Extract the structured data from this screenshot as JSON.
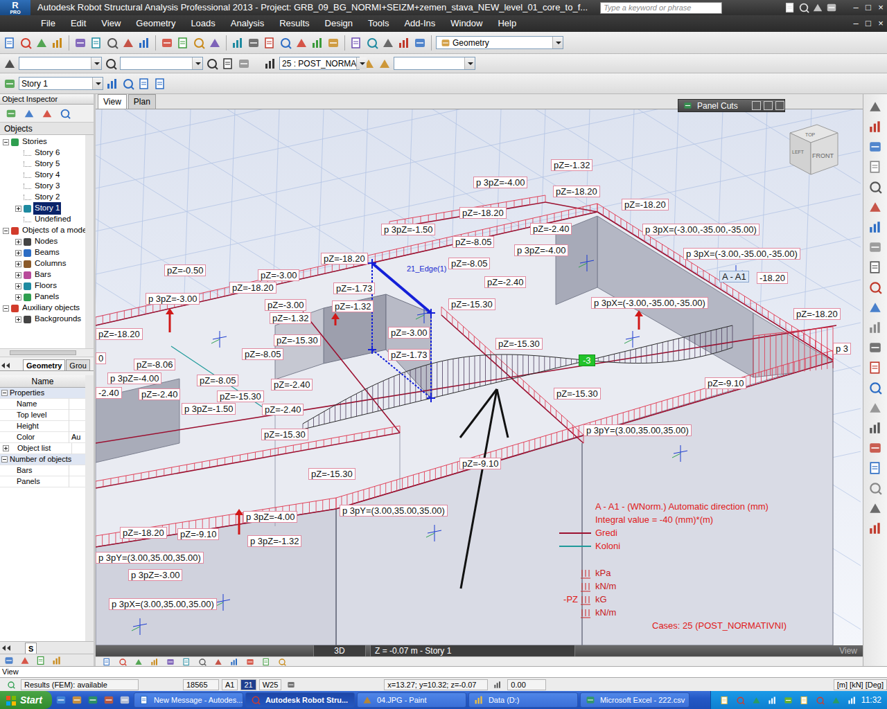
{
  "window": {
    "title": "Autodesk Robot Structural Analysis Professional 2013 - Project: GRB_09_BG_NORMI+SEIZM+zemen_stava_NEW_level_01_core_to_f...",
    "logo": "R",
    "logo_sub": "PRO",
    "search_placeholder": "Type a keyword or phrase",
    "controls": [
      "–",
      "□",
      "×"
    ],
    "doc_controls": [
      "–",
      "□",
      "×"
    ]
  },
  "menu": [
    "File",
    "Edit",
    "View",
    "Geometry",
    "Loads",
    "Analysis",
    "Results",
    "Design",
    "Tools",
    "Add-Ins",
    "Window",
    "Help"
  ],
  "toolbar": {
    "layout": "Geometry",
    "case": "25 : POST_NORMA",
    "story": "Story 1"
  },
  "inspector": {
    "title": "Object Inspector",
    "objects_label": "Objects",
    "tree": [
      {
        "label": "Stories",
        "level": 0,
        "kind": "branch",
        "expanded": true,
        "selected": false
      },
      {
        "label": "Story 6",
        "level": 1,
        "kind": "leaf",
        "expanded": false,
        "selected": false
      },
      {
        "label": "Story 5",
        "level": 1,
        "kind": "leaf",
        "expanded": false,
        "selected": false
      },
      {
        "label": "Story 4",
        "level": 1,
        "kind": "leaf",
        "expanded": false,
        "selected": false
      },
      {
        "label": "Story 3",
        "level": 1,
        "kind": "leaf",
        "expanded": false,
        "selected": false
      },
      {
        "label": "Story 2",
        "level": 1,
        "kind": "leaf",
        "expanded": false,
        "selected": false
      },
      {
        "label": "Story 1",
        "level": 1,
        "kind": "branch",
        "expanded": false,
        "selected": true
      },
      {
        "label": "Undefined",
        "level": 1,
        "kind": "leaf",
        "expanded": false,
        "selected": false
      },
      {
        "label": "Objects of a model",
        "level": 0,
        "kind": "branch",
        "expanded": true,
        "selected": false
      },
      {
        "label": "Nodes",
        "level": 1,
        "kind": "branch",
        "expanded": false,
        "selected": false
      },
      {
        "label": "Beams",
        "level": 1,
        "kind": "branch",
        "expanded": false,
        "selected": false
      },
      {
        "label": "Columns",
        "level": 1,
        "kind": "branch",
        "expanded": false,
        "selected": false
      },
      {
        "label": "Bars",
        "level": 1,
        "kind": "branch",
        "expanded": false,
        "selected": false
      },
      {
        "label": "Floors",
        "level": 1,
        "kind": "branch",
        "expanded": false,
        "selected": false
      },
      {
        "label": "Panels",
        "level": 1,
        "kind": "branch",
        "expanded": false,
        "selected": false
      },
      {
        "label": "Auxiliary objects",
        "level": 0,
        "kind": "branch",
        "expanded": true,
        "selected": false
      },
      {
        "label": "Backgrounds",
        "level": 1,
        "kind": "branch",
        "expanded": false,
        "selected": false
      }
    ],
    "tabs": [
      {
        "label": "Geometry",
        "selected": true
      },
      {
        "label": "Grou",
        "selected": false
      }
    ],
    "grid_header": "Name",
    "grid": [
      {
        "label": "Properties",
        "kind": "group",
        "expanded": true
      },
      {
        "label": "Name",
        "kind": "row"
      },
      {
        "label": "Top level",
        "kind": "row"
      },
      {
        "label": "Height",
        "kind": "row"
      },
      {
        "label": "Color",
        "kind": "row",
        "value": "Au"
      },
      {
        "label": "Object list",
        "kind": "subgroup",
        "expanded": false
      },
      {
        "label": "Number of objects",
        "kind": "group",
        "expanded": true
      },
      {
        "label": "Bars",
        "kind": "row"
      },
      {
        "label": "Panels",
        "kind": "row"
      }
    ],
    "bottom_tab": "S"
  },
  "view_tabs": [
    {
      "label": "View",
      "selected": true
    },
    {
      "label": "Plan",
      "selected": false
    }
  ],
  "panel_cuts": {
    "title": "Panel Cuts"
  },
  "view_cube": {
    "top": "TOP",
    "left": "LEFT",
    "front": "FRONT"
  },
  "labels": [
    {
      "text": "pZ=-1.32",
      "kind": "load"
    },
    {
      "text": "p 3pZ=-4.00",
      "kind": "load"
    },
    {
      "text": "pZ=-18.20",
      "kind": "load"
    },
    {
      "text": "pZ=-18.20",
      "kind": "load"
    },
    {
      "text": "pZ=-18.20",
      "kind": "load"
    },
    {
      "text": "p 3pZ=-1.50",
      "kind": "load"
    },
    {
      "text": "pZ=-2.40",
      "kind": "load"
    },
    {
      "text": "p 3pX=(-3.00,-35.00,-35.00)",
      "kind": "load"
    },
    {
      "text": "pZ=-8.05",
      "kind": "load"
    },
    {
      "text": "p 3pZ=-4.00",
      "kind": "load"
    },
    {
      "text": "p 3pX=(-3.00,-35.00,-35.00)",
      "kind": "load"
    },
    {
      "text": "pZ=-18.20",
      "kind": "load"
    },
    {
      "text": "pZ=-8.05",
      "kind": "load"
    },
    {
      "text": "pZ=-0.50",
      "kind": "load"
    },
    {
      "text": "pZ=-3.00",
      "kind": "load"
    },
    {
      "text": "A - A1",
      "kind": "cut"
    },
    {
      "text": "-18.20",
      "kind": "load"
    },
    {
      "text": "pZ=-2.40",
      "kind": "load"
    },
    {
      "text": "pZ=-18.20",
      "kind": "load"
    },
    {
      "text": "pZ=-1.73",
      "kind": "load"
    },
    {
      "text": "p 3pZ=-3.00",
      "kind": "load"
    },
    {
      "text": "p 3pX=(-3.00,-35.00,-35.00)",
      "kind": "load"
    },
    {
      "text": "pZ=-3.00",
      "kind": "load"
    },
    {
      "text": "pZ=-1.32",
      "kind": "load"
    },
    {
      "text": "pZ=-15.30",
      "kind": "load"
    },
    {
      "text": "pZ=-18.20",
      "kind": "load"
    },
    {
      "text": "pZ=-1.32",
      "kind": "load"
    },
    {
      "text": "pZ=-18.20",
      "kind": "load"
    },
    {
      "text": "pZ=-3.00",
      "kind": "load"
    },
    {
      "text": "pZ=-15.30",
      "kind": "load"
    },
    {
      "text": "pZ=-15.30",
      "kind": "load"
    },
    {
      "text": "p 3",
      "kind": "load"
    },
    {
      "text": "0",
      "kind": "load"
    },
    {
      "text": "pZ=-8.05",
      "kind": "load"
    },
    {
      "text": "pZ=-1.73",
      "kind": "load"
    },
    {
      "text": "-3",
      "kind": "marker"
    },
    {
      "text": "pZ=-8.06",
      "kind": "load"
    },
    {
      "text": "p 3pZ=-4.00",
      "kind": "load"
    },
    {
      "text": "pZ=-8.05",
      "kind": "load"
    },
    {
      "text": "pZ=-2.40",
      "kind": "load"
    },
    {
      "text": "pZ=-9.10",
      "kind": "load"
    },
    {
      "text": "-2.40",
      "kind": "load"
    },
    {
      "text": "pZ=-2.40",
      "kind": "load"
    },
    {
      "text": "pZ=-15.30",
      "kind": "load"
    },
    {
      "text": "pZ=-15.30",
      "kind": "load"
    },
    {
      "text": "p 3pZ=-1.50",
      "kind": "load"
    },
    {
      "text": "pZ=-2.40",
      "kind": "load"
    },
    {
      "text": "p 3pY=(3.00,35.00,35.00)",
      "kind": "load"
    },
    {
      "text": "pZ=-15.30",
      "kind": "load"
    },
    {
      "text": "pZ=-9.10",
      "kind": "load"
    },
    {
      "text": "pZ=-15.30",
      "kind": "load"
    },
    {
      "text": "p 3pY=(3.00,35.00,35.00)",
      "kind": "load"
    },
    {
      "text": "p 3pZ=-4.00",
      "kind": "load"
    },
    {
      "text": "pZ=-18.20",
      "kind": "load"
    },
    {
      "text": "pZ=-9.10",
      "kind": "load"
    },
    {
      "text": "p 3pZ=-1.32",
      "kind": "load"
    },
    {
      "text": "p 3pY=(3.00,35.00,35.00)",
      "kind": "load"
    },
    {
      "text": "p 3pZ=-3.00",
      "kind": "load"
    },
    {
      "text": "p 3pX=(3.00,35.00,35.00)",
      "kind": "load"
    },
    {
      "text": "21_Edge(1)",
      "kind": "edge"
    }
  ],
  "legend": {
    "cut_title": "A - A1 - (WNorm.) Automatic direction (mm)",
    "integral": "Integral value = -40 (mm)*(m)",
    "series": [
      {
        "label": "Gredi",
        "color": "#9b1030"
      },
      {
        "label": "Koloni",
        "color": "#1e9a9a"
      }
    ],
    "units": [
      {
        "prefix": "",
        "unit": "kPa"
      },
      {
        "prefix": "",
        "unit": "kN/m"
      },
      {
        "prefix": "-PZ",
        "unit": "kG"
      },
      {
        "prefix": "",
        "unit": "kN/m"
      }
    ],
    "cases": "Cases: 25 (POST_NORMATIVNI)"
  },
  "view_strip": {
    "mode": "3D",
    "level": "Z = -0.07 m - Story 1",
    "view": "View"
  },
  "command_line": "View",
  "status_bar": [
    {
      "text": "Results (FEM): available",
      "selected": false
    },
    {
      "text": "18565",
      "selected": false
    },
    {
      "text": "A1",
      "selected": false
    },
    {
      "text": "21",
      "selected": true
    },
    {
      "text": "W25",
      "selected": false
    },
    {
      "text": "x=13.27; y=10.32; z=-0.07",
      "selected": false
    },
    {
      "text": "0.00",
      "selected": false
    },
    {
      "text": "[m] [kN] [Deg]",
      "selected": false
    }
  ],
  "taskbar": {
    "start": "Start",
    "tasks": [
      {
        "label": "New Message - Autodes...",
        "selected": false
      },
      {
        "label": "Autodesk Robot Stru...",
        "selected": true
      },
      {
        "label": "04.JPG - Paint",
        "selected": false
      },
      {
        "label": "Data (D:)",
        "selected": false
      },
      {
        "label": "Microsoft Excel - 222.csv",
        "selected": false
      }
    ],
    "clock": "11:32"
  }
}
